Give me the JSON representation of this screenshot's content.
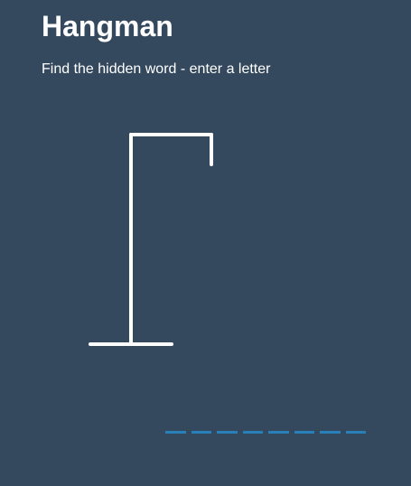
{
  "game": {
    "title": "Hangman",
    "instructions": "Find the hidden word - enter a letter"
  },
  "word": {
    "length": 8,
    "revealed_letters": [
      "",
      "",
      "",
      "",
      "",
      "",
      "",
      ""
    ],
    "blank_color": "#2980b9"
  },
  "colors": {
    "background": "#34495e",
    "text": "#ffffff",
    "gallows": "#ffffff"
  }
}
